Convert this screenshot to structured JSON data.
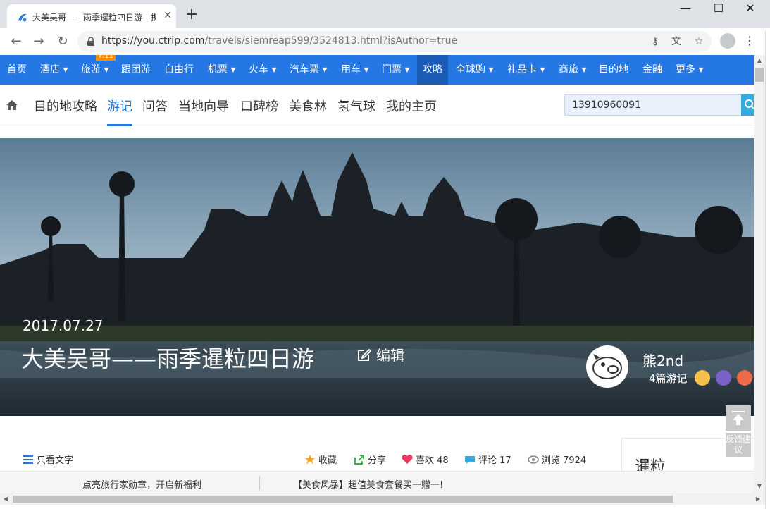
{
  "browser": {
    "tab_title": "大美吴哥——雨季暹粒四日游 - 携",
    "url_host": "https://you.ctrip.com",
    "url_path": "/travels/siemreap599/3524813.html?isAuthor=true",
    "window_controls": [
      "—",
      "☐",
      "✕"
    ]
  },
  "main_nav": {
    "items": [
      {
        "label": "首页"
      },
      {
        "label": "酒店 ▾"
      },
      {
        "label": "旅游 ▾"
      },
      {
        "label": "跟团游"
      },
      {
        "label": "自由行"
      },
      {
        "label": "机票 ▾"
      },
      {
        "label": "火车 ▾"
      },
      {
        "label": "汽车票 ▾"
      },
      {
        "label": "用车 ▾"
      },
      {
        "label": "门票 ▾"
      },
      {
        "label": "攻略"
      },
      {
        "label": "全球购 ▾"
      },
      {
        "label": "礼品卡 ▾"
      },
      {
        "label": "商旅 ▾"
      },
      {
        "label": "目的地"
      },
      {
        "label": "金融"
      },
      {
        "label": "更多 ▾"
      }
    ],
    "badge": "7.11"
  },
  "sub_nav": {
    "items": [
      "目的地攻略",
      "游记",
      "问答",
      "当地向导",
      "口碑榜",
      "美食林",
      "氢气球",
      "我的主页"
    ],
    "search_value": "13910960091"
  },
  "hero": {
    "date": "2017.07.27",
    "title": "大美吴哥——雨季暹粒四日游",
    "edit_label": "编辑",
    "author_name": "熊2nd",
    "author_count": "4篇游记"
  },
  "toolbar": {
    "text_only": "只看文字",
    "favorite": "收藏",
    "share": "分享",
    "like": "喜欢 48",
    "comment": "评论 17",
    "views": "浏览 7924"
  },
  "sidebar": {
    "title": "暹粒",
    "feedback": "反馈建议"
  },
  "footer": {
    "promo_1": "点亮旅行家勋章，开启新福利",
    "promo_2": "【美食风暴】超值美食套餐买一赠一!"
  },
  "colors": {
    "nav_blue": "#2577e3",
    "nav_active": "#1a5cb6",
    "badge_orange": "#ff8a00"
  }
}
